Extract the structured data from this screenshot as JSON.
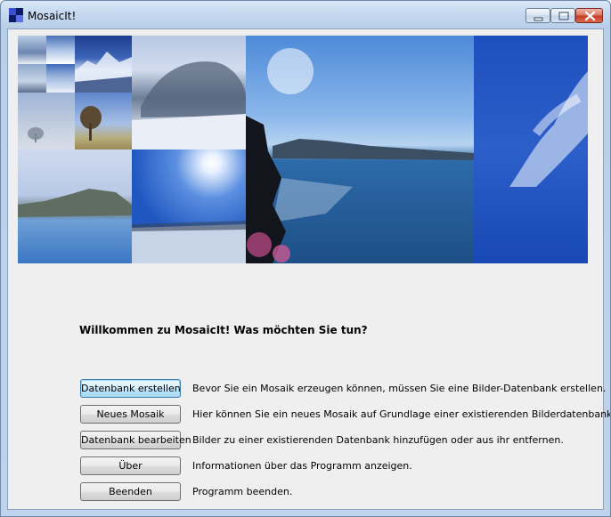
{
  "window": {
    "title": "MosaicIt!",
    "accent": "#1b2a8a"
  },
  "banner": {
    "icon": "mosaic-image"
  },
  "main": {
    "heading": "Willkommen zu MosaicIt! Was möchten Sie tun?",
    "actions": [
      {
        "label": "Datenbank erstellen",
        "description": "Bevor Sie ein Mosaik erzeugen können, müssen Sie eine Bilder-Datenbank erstellen."
      },
      {
        "label": "Neues Mosaik",
        "description": "Hier können Sie ein neues Mosaik auf Grundlage einer existierenden Bilderdatenbank erstellen."
      },
      {
        "label": "Datenbank bearbeiten",
        "description": "Bilder zu einer existierenden Datenbank hinzufügen oder aus ihr entfernen."
      },
      {
        "label": "Über",
        "description": "Informationen über das Programm anzeigen."
      },
      {
        "label": "Beenden",
        "description": "Programm beenden."
      }
    ]
  }
}
